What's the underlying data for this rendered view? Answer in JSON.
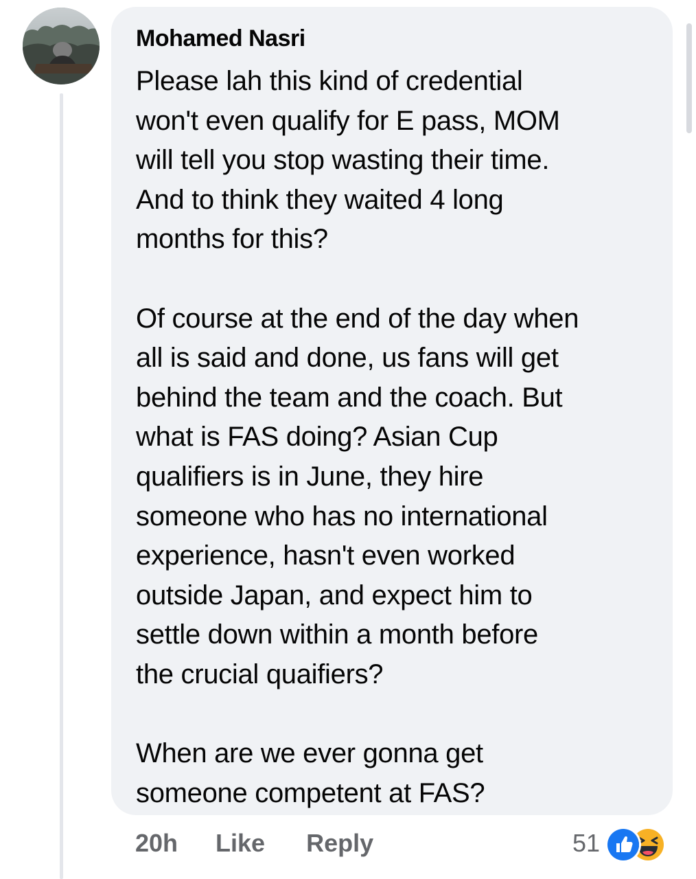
{
  "comment": {
    "author": "Mohamed Nasri",
    "paragraphs": [
      [
        "Please lah this kind of credential",
        "won't even qualify for E pass, MOM",
        "will tell you stop wasting their time.",
        "And to think they waited 4 long",
        "months for this?"
      ],
      [
        "Of course at the end of the day when",
        "all is said and done, us fans will get",
        "behind the team and the coach. But",
        "what is FAS doing? Asian Cup",
        "qualifiers is in June, they hire",
        "someone who has no international",
        "experience, hasn't even worked",
        "outside Japan, and expect him to",
        "settle down within a month before",
        "the crucial quaifiers?"
      ],
      [
        "When are we ever gonna get",
        "someone competent at FAS?"
      ]
    ]
  },
  "actions": {
    "time": "20h",
    "like_label": "Like",
    "reply_label": "Reply"
  },
  "reactions": {
    "count": "51",
    "icons": [
      "like-reaction-icon",
      "haha-reaction-icon"
    ]
  },
  "colors": {
    "bubble": "#f0f2f5",
    "meta_text": "#65676b",
    "like_blue": "#1877f2",
    "haha_yellow": "#f7b125"
  }
}
